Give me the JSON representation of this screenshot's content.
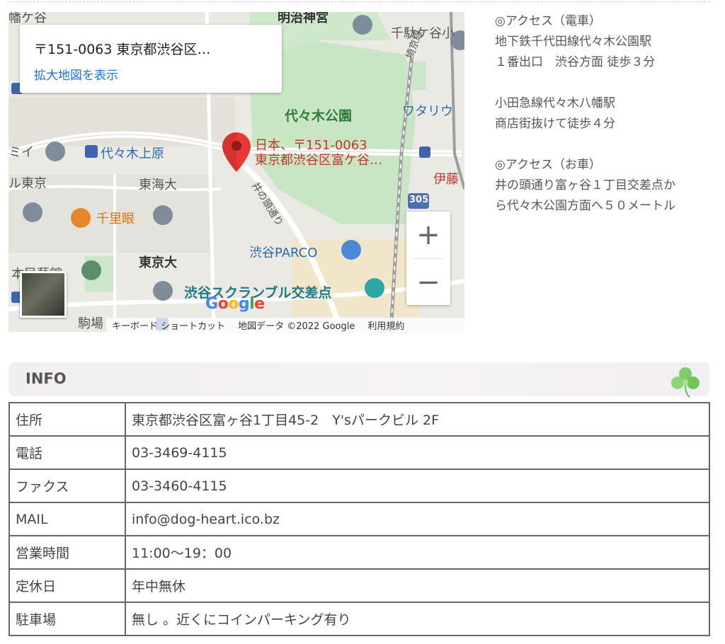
{
  "map": {
    "info_card": {
      "address": "〒151-0063 東京都渋谷区…",
      "view_larger_link": "拡大地図を表示"
    },
    "marker": {
      "line1": "日本、〒151-0063",
      "line2": "東京都渋谷区富ケ谷…"
    },
    "labels": {
      "shrine": "明治神宮",
      "sendagaya": "千駄ケ谷小",
      "yoyogi_park": "代々木公園",
      "watari": "ワタリウ",
      "saikyo": "埼京線",
      "mi": "ミイ",
      "yoyogi_uehara": "代々木上原",
      "tokyo": "ル東京",
      "tokai": "東海大",
      "senrigan": "千里眼",
      "inokashira": "井の頭通り",
      "ito": "伊藤",
      "route": "305",
      "parco": "渋谷PARCO",
      "todai": "東京大",
      "mingeikan": "本民藝館",
      "scramble": "渋谷スクランブル交差点",
      "komaba": "駒場",
      "hatagaya": "幡ケ谷"
    },
    "zoom_in": "+",
    "zoom_out": "−",
    "logo": [
      "G",
      "o",
      "o",
      "g",
      "l",
      "e"
    ],
    "attribution": {
      "shortcuts": "キーボード ショートカット",
      "data": "地図データ ©2022 Google",
      "terms": "利用規約"
    }
  },
  "access": {
    "train_heading": "◎アクセス（電車）",
    "train_line1": "地下鉄千代田線代々木公園駅",
    "train_line2": "１番出口　渋谷方面 徒歩３分",
    "odakyu_line1": "小田急線代々木八幡駅",
    "odakyu_line2": "商店街抜けて徒歩４分",
    "car_heading": "◎アクセス（お車）",
    "car_line1": "井の頭通り富ヶ谷１丁目交差点か",
    "car_line2": "ら代々木公園方面へ５０メートル"
  },
  "info": {
    "title": "INFO",
    "rows": [
      {
        "key": "住所",
        "value": "東京都渋谷区富ヶ谷1丁目45-2　Y'sパークビル 2F"
      },
      {
        "key": "電話",
        "value": "03-3469-4115"
      },
      {
        "key": "ファクス",
        "value": "03-3460-4115"
      },
      {
        "key": "MAIL",
        "value": "info@dog-heart.ico.bz"
      },
      {
        "key": "営業時間",
        "value": "11:00〜19：00"
      },
      {
        "key": "定休日",
        "value": "年中無休"
      },
      {
        "key": "駐車場",
        "value": "無し 。近くにコインパーキング有り"
      }
    ]
  },
  "colors": {
    "link": "#1a73e8",
    "park_green": "#2f7a3d",
    "marker_red": "#c0392b",
    "table_border": "#666666"
  }
}
